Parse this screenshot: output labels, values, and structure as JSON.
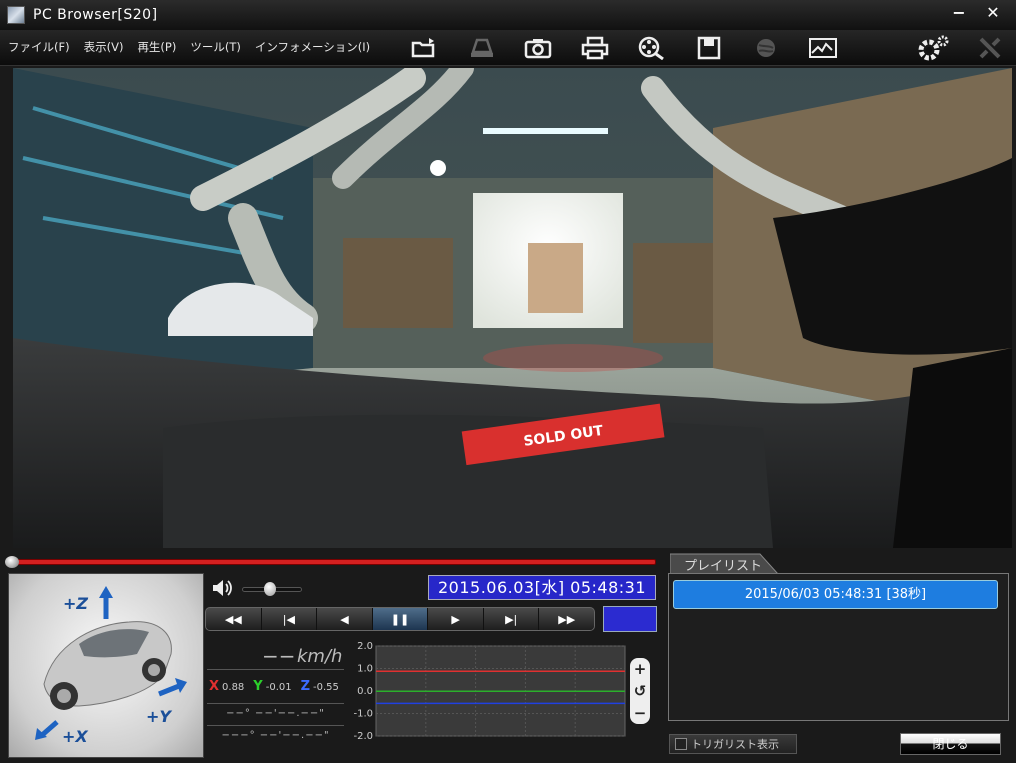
{
  "window": {
    "title": "PC Browser[S20]",
    "minimize": "−",
    "close": "✕"
  },
  "menu": [
    "ファイル(F)",
    "表示(V)",
    "再生(P)",
    "ツール(T)",
    "インフォメーション(I)"
  ],
  "toolbar_icons": [
    "open-folder-icon",
    "eject-icon",
    "camera-icon",
    "print-icon",
    "film-reel-search-icon",
    "save-icon",
    "globe-icon",
    "map-icon",
    "settings-gear-icon",
    "tools-disabled-icon"
  ],
  "video": {
    "stamp_text": "SOLD OUT"
  },
  "gsensor": {
    "z_label": "+Z",
    "y_label": "+Y",
    "x_label": "+X"
  },
  "playback": {
    "datetime": "2015.06.03[水] 05:48:31",
    "speed_value": "−−",
    "speed_unit": "km/h",
    "x_label": "X",
    "x_value": "0.88",
    "y_label": "Y",
    "y_value": "-0.01",
    "z_label": "Z",
    "z_value": "-0.55",
    "latitude": "−−°  −−'−−.−−\"",
    "longitude": "−−−°  −−'−−.−−\"",
    "controls": [
      "◀◀",
      "|◀",
      "◀",
      "❚❚",
      "▶",
      "▶|",
      "▶▶"
    ],
    "active_control_index": 3,
    "progress": 0.0
  },
  "graph": {
    "y_ticks": [
      "2.0",
      "1.0",
      "0.0",
      "-1.0",
      "-2.0"
    ],
    "ylim": [
      -2,
      2
    ],
    "lines": [
      {
        "color": "#e03030",
        "value": 0.88
      },
      {
        "color": "#2bb02b",
        "value": -0.01
      },
      {
        "color": "#2040e0",
        "value": -0.55
      }
    ]
  },
  "zoom": {
    "plus": "+",
    "reset": "↺",
    "minus": "−"
  },
  "playlist": {
    "tab_label": "プレイリスト",
    "items": [
      "2015/06/03 05:48:31 [38秒]"
    ],
    "trigger_label": "トリガリスト表示",
    "close_label": "閉じる"
  }
}
